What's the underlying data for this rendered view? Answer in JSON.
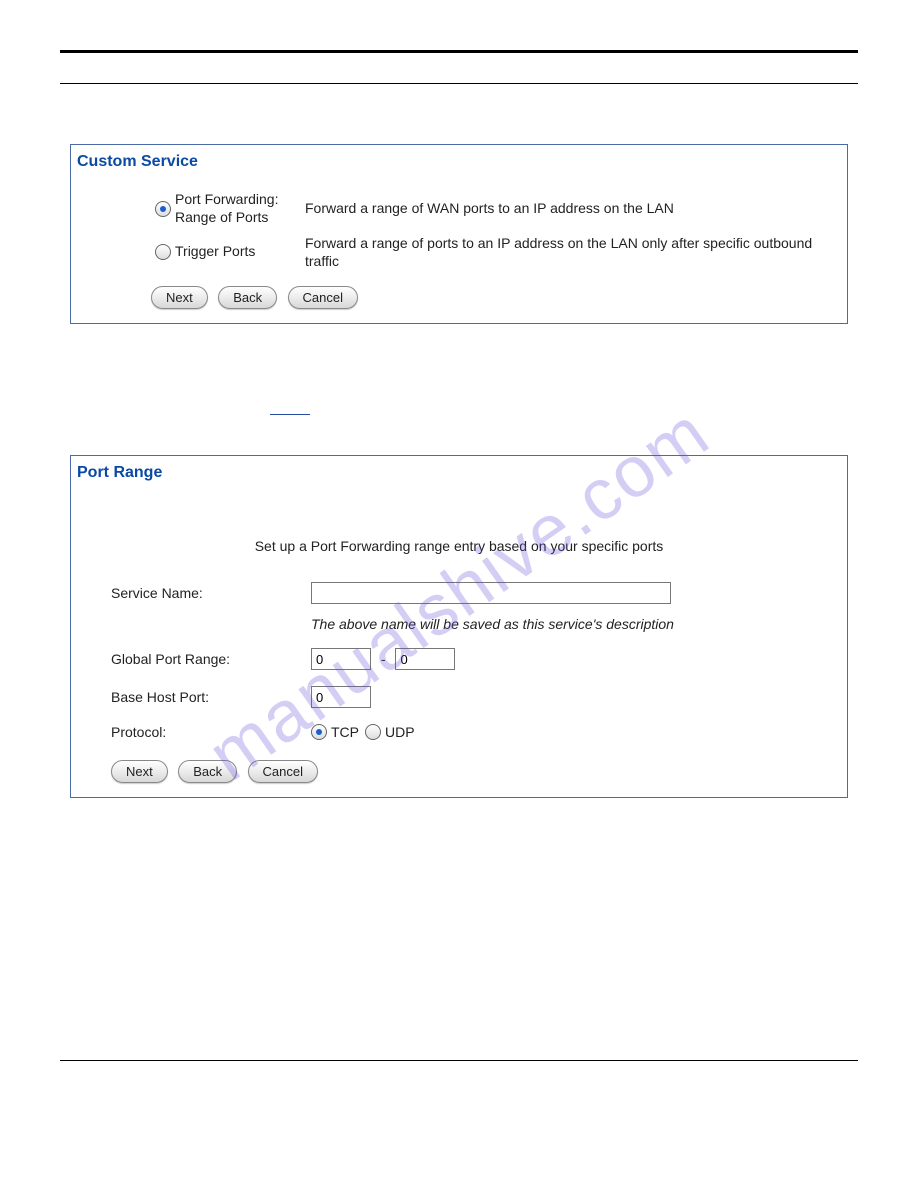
{
  "watermark": "manualshive.com",
  "panel1": {
    "title": "Custom Service",
    "options": [
      {
        "label_line1": "Port Forwarding:",
        "label_line2": "Range of Ports",
        "desc": "Forward a range of WAN ports to an IP address on the LAN",
        "checked": true
      },
      {
        "label": "Trigger Ports",
        "desc": "Forward a range of ports to an IP address on the LAN only after specific outbound traffic",
        "checked": false
      }
    ],
    "buttons": {
      "next": "Next",
      "back": "Back",
      "cancel": "Cancel"
    }
  },
  "panel2": {
    "title": "Port Range",
    "intro": "Set up a Port Forwarding range entry based on your specific ports",
    "fields": {
      "service_name_label": "Service Name:",
      "service_name_value": "",
      "hint": "The above name will be saved as this service's description",
      "global_port_label": "Global Port Range:",
      "global_port_from": "0",
      "global_port_to": "0",
      "base_host_label": "Base Host Port:",
      "base_host_value": "0",
      "protocol_label": "Protocol:",
      "tcp_label": "TCP",
      "udp_label": "UDP"
    },
    "buttons": {
      "next": "Next",
      "back": "Back",
      "cancel": "Cancel"
    }
  },
  "dash": "-"
}
